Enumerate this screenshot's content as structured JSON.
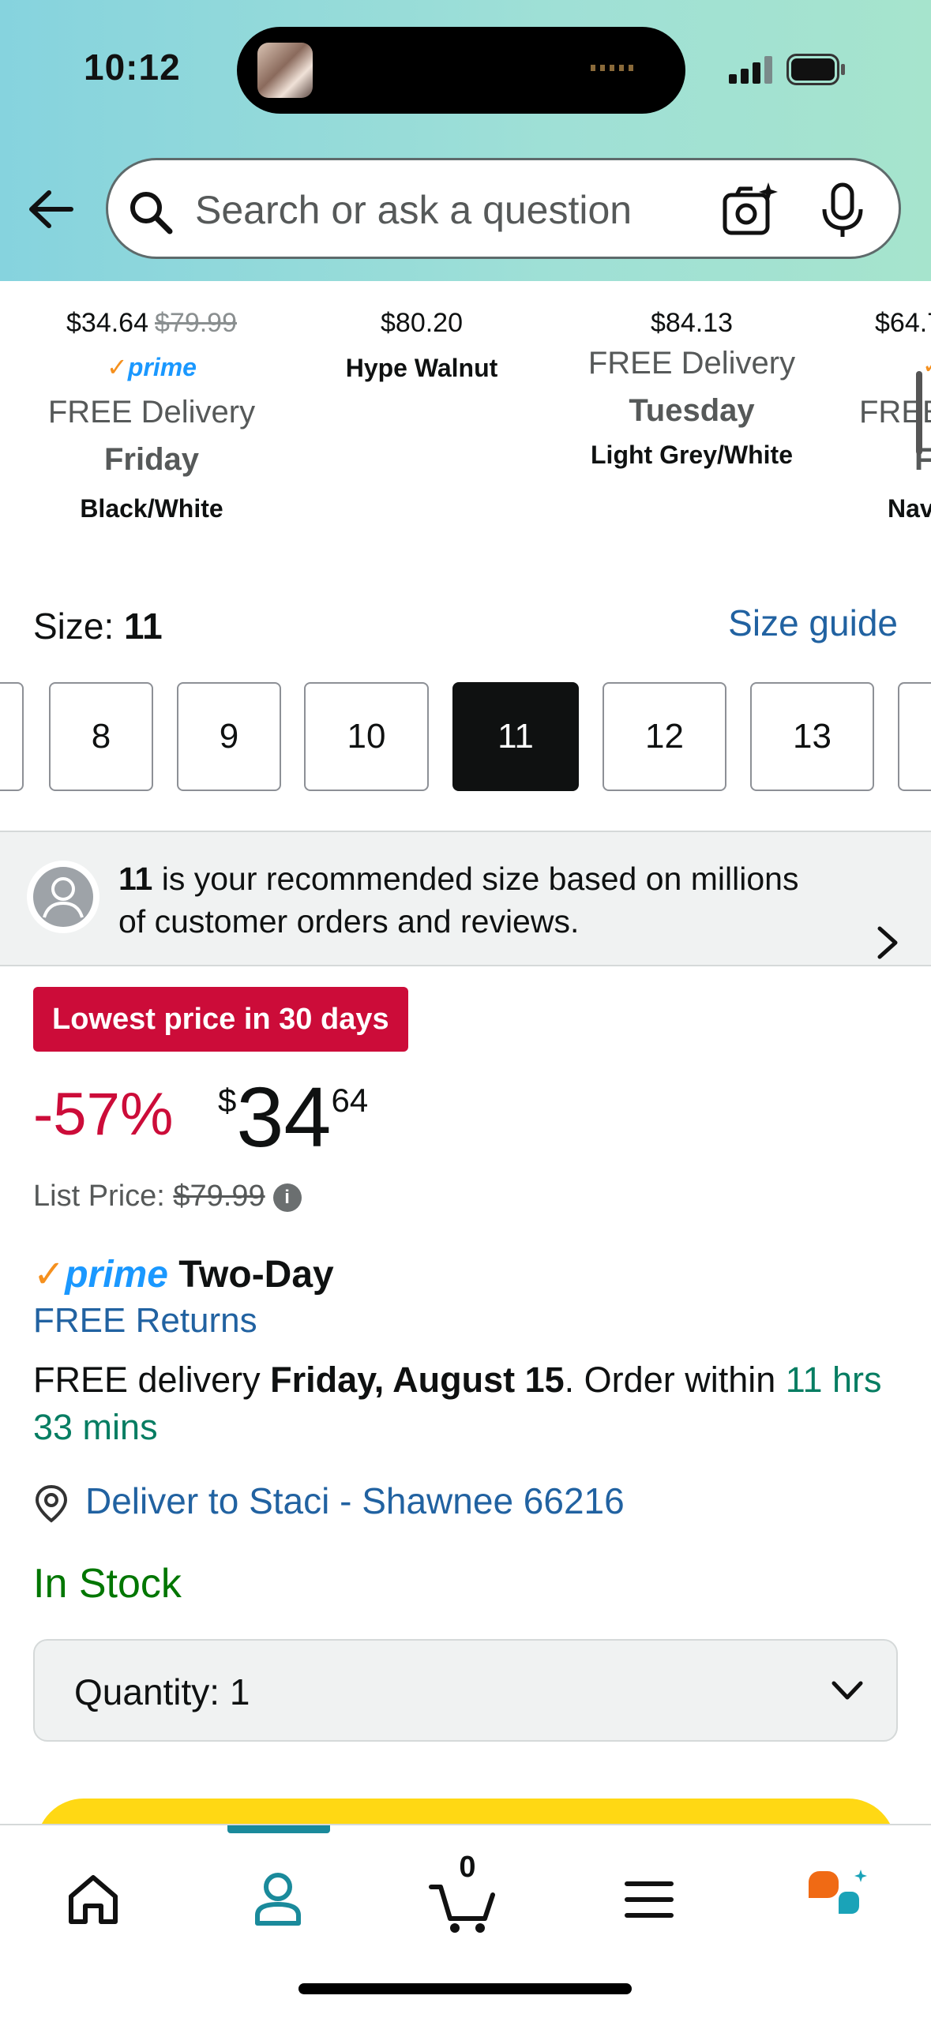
{
  "status_bar": {
    "time": "10:12"
  },
  "search": {
    "placeholder": "Search or ask a question"
  },
  "variants": [
    {
      "price": "$34.64",
      "list_price": "$79.99",
      "prime": "prime",
      "delivery": "FREE Delivery",
      "day": "Friday",
      "color": "Black/White"
    },
    {
      "price": "$80.20",
      "name": "Hype Walnut"
    },
    {
      "price": "$84.13",
      "delivery": "FREE Delivery",
      "day": "Tuesday",
      "color": "Light Grey/White"
    },
    {
      "price": "$64.7",
      "delivery": "FREE",
      "day": "F",
      "color": "Nav"
    }
  ],
  "size": {
    "label": "Size:",
    "selected": "11",
    "guide_label": "Size guide",
    "options": [
      "8",
      "9",
      "10",
      "11",
      "12",
      "13"
    ]
  },
  "recommendation": {
    "size": "11",
    "text": " is your recommended size based on millions of customer orders and reviews."
  },
  "deal": {
    "badge": "Lowest price in 30 days",
    "discount": "-57%",
    "currency": "$",
    "price_whole": "34",
    "price_fraction": "64",
    "list_price_label": "List Price:",
    "list_price": "$79.99"
  },
  "shipping": {
    "prime_logo": "prime",
    "prime_type": "Two-Day",
    "returns": "FREE Returns",
    "delivery_prefix": "FREE delivery ",
    "delivery_date": "Friday, August 15",
    "delivery_mid": ". Order within ",
    "countdown": "11 hrs 33 mins",
    "deliver_to": "Deliver to Staci - Shawnee 66216",
    "stock": "In Stock"
  },
  "quantity": {
    "label": "Quantity:",
    "value": "1"
  },
  "bottom_nav": {
    "items": [
      "home-icon",
      "account-icon",
      "cart-icon",
      "menu-icon",
      "rufus-icon"
    ],
    "cart_count": "0",
    "active": "account-icon"
  },
  "colors": {
    "header_start": "#86d3de",
    "header_end": "#a6e4cd",
    "link_blue": "#2162a1",
    "deal_red": "#cc0c39",
    "stock_green": "#007600",
    "buy_yellow": "#ffd814",
    "prime_blue": "#1a98ff",
    "nav_teal": "#1a8a9b"
  }
}
